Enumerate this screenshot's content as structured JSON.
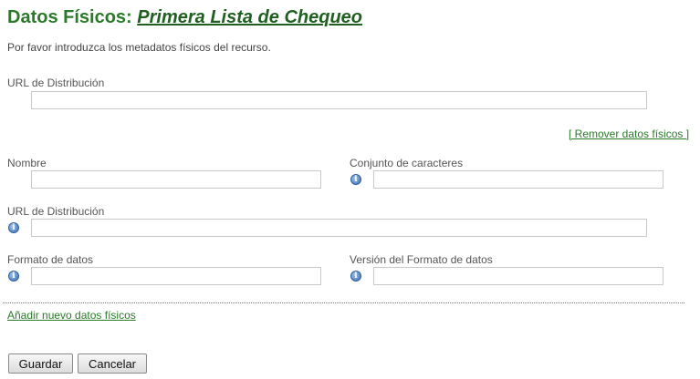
{
  "header": {
    "title_prefix": "Datos Físicos:",
    "title_link": "Primera Lista de Chequeo",
    "intro": "Por favor introduzca los metadatos físicos del recurso."
  },
  "section1": {
    "url_label": "URL de Distribución",
    "url_value": "",
    "remove_link": "[ Remover datos físicos ]"
  },
  "section2": {
    "name_label": "Nombre",
    "name_value": "",
    "charset_label": "Conjunto de caracteres",
    "charset_value": "",
    "url_label": "URL de Distribución",
    "url_value": "",
    "format_label": "Formato de datos",
    "format_value": "",
    "format_version_label": "Versión del Formato de datos",
    "format_version_value": ""
  },
  "add_link": "Añadir nuevo datos físicos",
  "buttons": {
    "save": "Guardar",
    "cancel": "Cancelar"
  },
  "icons": {
    "info": "info-icon"
  },
  "colors": {
    "title_green": "#2a7a2a",
    "link_green": "#2a7a2a"
  }
}
